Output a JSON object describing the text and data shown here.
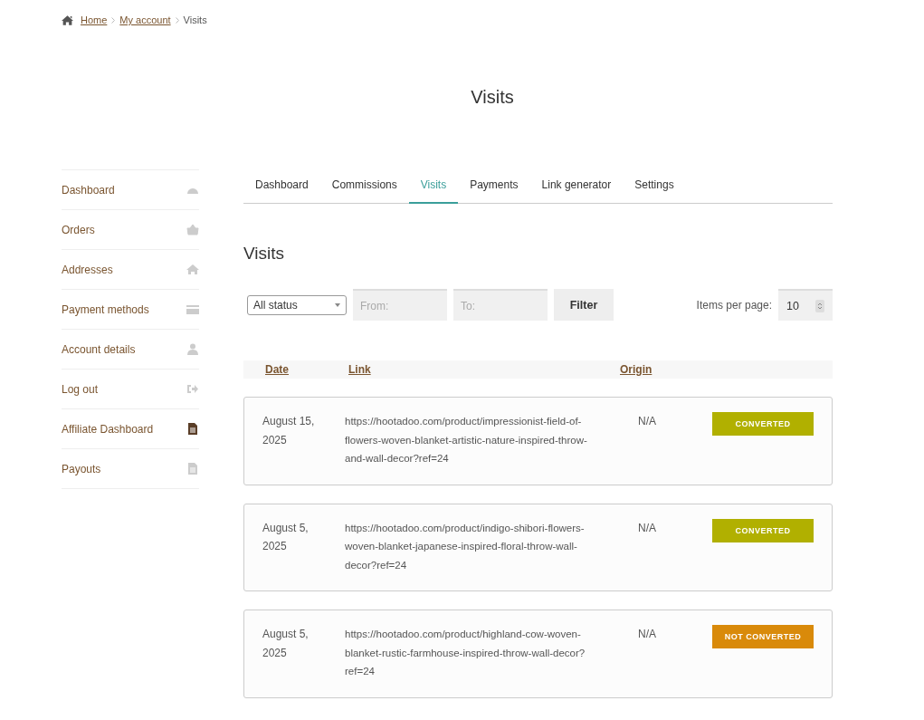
{
  "breadcrumb": [
    "Home",
    "My account",
    "Visits"
  ],
  "page_title": "Visits",
  "sidebar": {
    "items": [
      {
        "label": "Dashboard",
        "selected": false
      },
      {
        "label": "Orders",
        "selected": false
      },
      {
        "label": "Addresses",
        "selected": false
      },
      {
        "label": "Payment methods",
        "selected": false
      },
      {
        "label": "Account details",
        "selected": false
      },
      {
        "label": "Log out",
        "selected": false
      },
      {
        "label": "Affiliate Dashboard",
        "selected": true
      },
      {
        "label": "Payouts",
        "selected": false
      }
    ]
  },
  "tabs": [
    {
      "label": "Dashboard",
      "selected": false
    },
    {
      "label": "Commissions",
      "selected": false
    },
    {
      "label": "Visits",
      "selected": true
    },
    {
      "label": "Payments",
      "selected": false
    },
    {
      "label": "Link generator",
      "selected": false
    },
    {
      "label": "Settings",
      "selected": false
    }
  ],
  "section_title": "Visits",
  "filters": {
    "status": "All status",
    "from": {
      "placeholder": "From:"
    },
    "to": {
      "placeholder": "To:"
    },
    "button": "Filter",
    "per_page_label": "Items per page:",
    "per_page": "10"
  },
  "table": {
    "columns": [
      "Date",
      "Link",
      "Origin"
    ],
    "rows": [
      {
        "date": "August 15, 2025",
        "link": "https://hootadoo.com/product/impressionist-field-of-flowers-woven-blanket-artistic-nature-inspired-throw-and-wall-decor?ref=24",
        "origin": "N/A",
        "status": {
          "kind": "converted",
          "label": "CONVERTED"
        }
      },
      {
        "date": "August 5, 2025",
        "link": "https://hootadoo.com/product/indigo-shibori-flowers-woven-blanket-japanese-inspired-floral-throw-wall-decor?ref=24",
        "origin": "N/A",
        "status": {
          "kind": "converted",
          "label": "CONVERTED"
        }
      },
      {
        "date": "August 5, 2025",
        "link": "https://hootadoo.com/product/highland-cow-woven-blanket-rustic-farmhouse-inspired-throw-wall-decor?ref=24",
        "origin": "N/A",
        "status": {
          "kind": "not_converted",
          "label": "NOT CONVERTED"
        }
      }
    ]
  }
}
